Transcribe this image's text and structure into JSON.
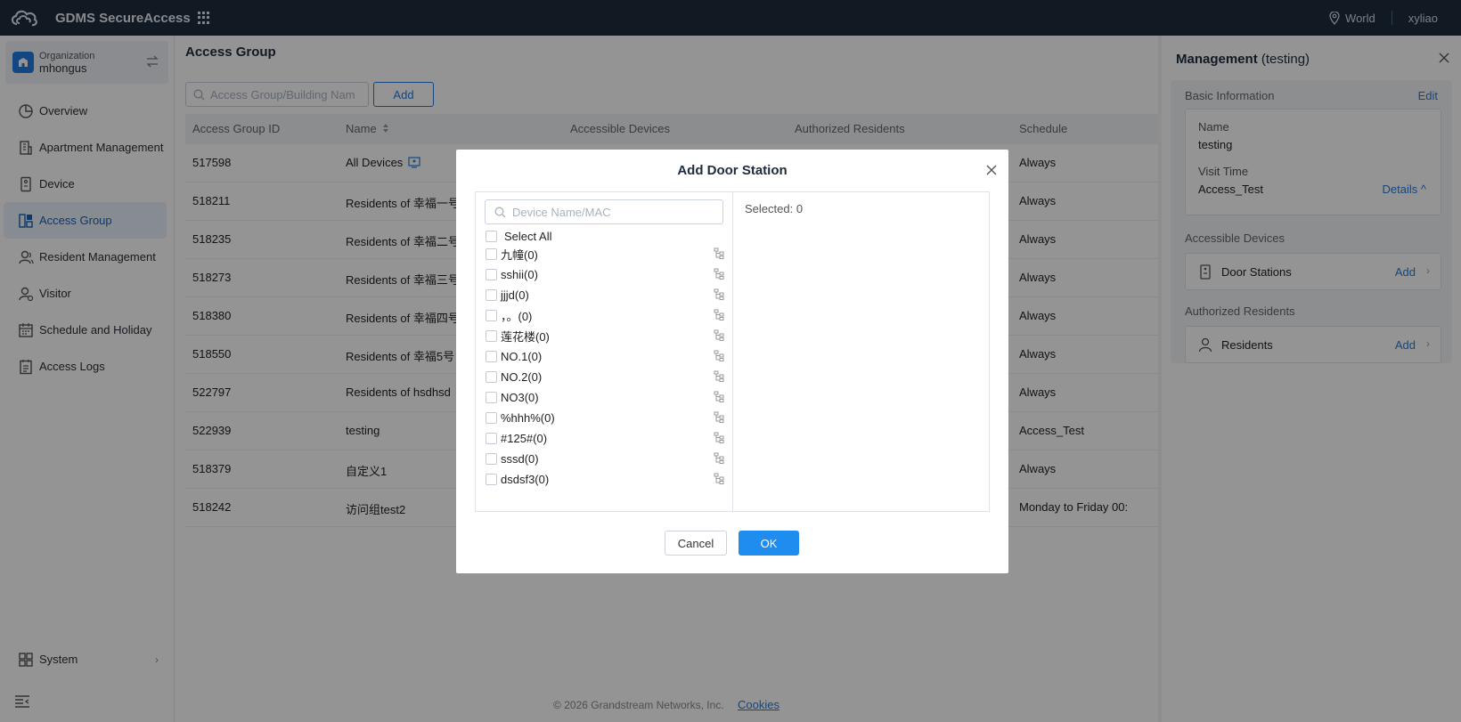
{
  "topbar": {
    "brand": "GDMS SecureAccess",
    "region": "World",
    "user": "xyliao"
  },
  "sidebar": {
    "org_label": "Organization",
    "org_name": "mhongus",
    "items": [
      {
        "label": "Overview",
        "icon": "overview-icon"
      },
      {
        "label": "Apartment Management",
        "icon": "apartment-icon"
      },
      {
        "label": "Device",
        "icon": "device-icon"
      },
      {
        "label": "Access Group",
        "icon": "access-group-icon",
        "active": true
      },
      {
        "label": "Resident Management",
        "icon": "resident-icon"
      },
      {
        "label": "Visitor",
        "icon": "visitor-icon"
      },
      {
        "label": "Schedule and Holiday",
        "icon": "calendar-icon"
      },
      {
        "label": "Access Logs",
        "icon": "logs-icon"
      }
    ],
    "system_label": "System"
  },
  "main": {
    "title": "Access Group",
    "search_placeholder": "Access Group/Building Nam",
    "add_label": "Add",
    "columns": [
      "Access Group ID",
      "Name",
      "Accessible Devices",
      "Authorized Residents",
      "Schedule"
    ],
    "rows": [
      {
        "id": "517598",
        "name": "All Devices",
        "schedule": "Always"
      },
      {
        "id": "518211",
        "name": "Residents of 幸福一号",
        "schedule": "Always"
      },
      {
        "id": "518235",
        "name": "Residents of 幸福二号",
        "schedule": "Always"
      },
      {
        "id": "518273",
        "name": "Residents of 幸福三号",
        "schedule": "Always"
      },
      {
        "id": "518380",
        "name": "Residents of 幸福四号",
        "schedule": "Always"
      },
      {
        "id": "518550",
        "name": "Residents of 幸福5号",
        "schedule": "Always"
      },
      {
        "id": "522797",
        "name": "Residents of hsdhsd",
        "schedule": "Always"
      },
      {
        "id": "522939",
        "name": "testing",
        "schedule": "Access_Test"
      },
      {
        "id": "518379",
        "name": "自定义1",
        "schedule": "Always"
      },
      {
        "id": "518242",
        "name": "访问组test2",
        "schedule": "Monday to Friday 00:"
      }
    ],
    "footer_copyright": "© 2026 Grandstream Networks, Inc.",
    "footer_cookies": "Cookies"
  },
  "panel": {
    "title": "Management",
    "title_suffix": "(testing)",
    "basic_info_label": "Basic Information",
    "edit_label": "Edit",
    "name_key": "Name",
    "name_value": "testing",
    "visit_time_key": "Visit Time",
    "visit_time_value": "Access_Test",
    "details_label": "Details ^",
    "accessible_devices_label": "Accessible Devices",
    "door_stations_label": "Door Stations",
    "authorized_residents_label": "Authorized Residents",
    "residents_label": "Residents",
    "add_label": "Add"
  },
  "modal": {
    "title": "Add Door Station",
    "search_placeholder": "Device Name/MAC",
    "select_all": "Select All",
    "items": [
      "九幢(0)",
      "sshii(0)",
      "jjjd(0)",
      "，。(0)",
      "莲花楼(0)",
      "NO.1(0)",
      "NO.2(0)",
      "NO3(0)",
      "%hhh%(0)",
      "#125#(0)",
      "sssd(0)",
      "dsdsf3(0)"
    ],
    "selected_label": "Selected: 0",
    "cancel_label": "Cancel",
    "ok_label": "OK"
  },
  "colors": {
    "topbar": "#1e2b3c",
    "accent": "#1f7be0",
    "ok_button": "#1f8cf0"
  }
}
